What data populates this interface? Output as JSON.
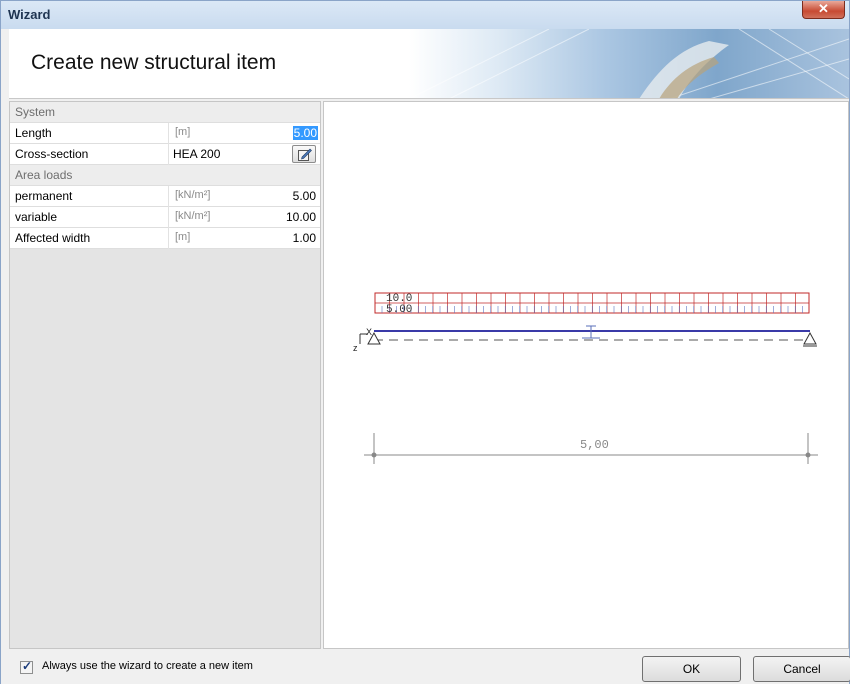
{
  "window": {
    "title": "Wizard",
    "close_glyph": "✕"
  },
  "header": {
    "title": "Create new structural item"
  },
  "properties": {
    "groups": [
      {
        "label": "System"
      },
      {
        "label": "Area loads"
      }
    ],
    "rows": [
      {
        "name": "Length",
        "unit": "[m]",
        "value": "5.00"
      },
      {
        "name": "Cross-section",
        "unit": "",
        "value": "HEA 200"
      },
      {
        "name": "permanent",
        "unit": "[kN/m²]",
        "value": "5.00"
      },
      {
        "name": "variable",
        "unit": "[kN/m²]",
        "value": "10.00"
      },
      {
        "name": "Affected width",
        "unit": "[m]",
        "value": "1.00"
      }
    ]
  },
  "drawing": {
    "load_label_top": "10.0",
    "load_label_bottom": "5.00",
    "axis_x": "X",
    "axis_z": "z",
    "dimension_label": "5,00",
    "beam_color": "#3a3aa8",
    "load_color": "#c02a2a"
  },
  "footer": {
    "checkbox_label": "Always use the wizard to create a new item",
    "checkbox_checked": "✓",
    "ok_label": "OK",
    "cancel_label": "Cancel"
  }
}
